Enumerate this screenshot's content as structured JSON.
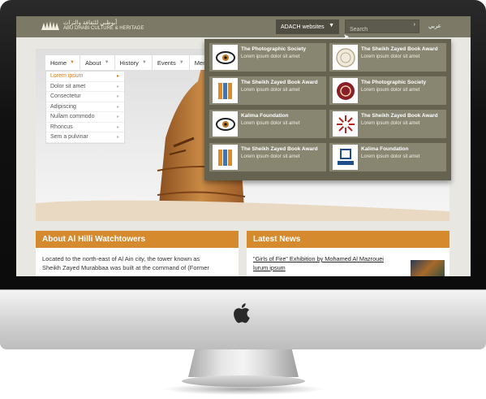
{
  "topbar": {
    "logo_ar": "أبوظبي للثقافة والتراث",
    "logo_en": "ABU DHABI CULTURE & HERITAGE",
    "adach_label": "ADACH websites",
    "search_placeholder": "Search",
    "search_go": "›",
    "lang": "عربي"
  },
  "nav": {
    "items": [
      "Home",
      "About",
      "History",
      "Events",
      "Menu I"
    ]
  },
  "submenu": {
    "items": [
      "Lorem ipsum",
      "Dolor sit amet",
      "Consectetur",
      "Adipiscing",
      "Nullam commodo",
      "Rhoncus",
      "Sem a pulvinar"
    ]
  },
  "dropdown": {
    "tiles": [
      {
        "title": "The Photographic Society",
        "desc": "Lorem ipsum dolor sit amet",
        "icon": "eye-icon"
      },
      {
        "title": "The Sheikh Zayed Book Award",
        "desc": "Lorem ipsum dolor sit amet",
        "icon": "seal-icon"
      },
      {
        "title": "The Sheikh Zayed Book Award",
        "desc": "Lorem ipsum dolor sit amet",
        "icon": "book-award-icon"
      },
      {
        "title": "The Photographic Society",
        "desc": "Lorem ipsum dolor sit amet",
        "icon": "red-seal-icon"
      },
      {
        "title": "Kalima Foundation",
        "desc": "Lorem ipsum dolor sit amet",
        "icon": "eye-icon"
      },
      {
        "title": "The Sheikh Zayed Book Award",
        "desc": "Lorem ipsum dolor sit amet",
        "icon": "sunburst-icon"
      },
      {
        "title": "The Sheikh Zayed Book Award",
        "desc": "Lorem ipsum dolor sit amet",
        "icon": "book-award-icon"
      },
      {
        "title": "Kalima Foundation",
        "desc": "Lorem ipsum dolor sit amet",
        "icon": "kalima-icon"
      }
    ]
  },
  "about": {
    "title": "About Al Hilli Watchtowers",
    "line1": "Located to the north-east of Al Ain city, the tower known as",
    "line2": "Sheikh Zayed Murabbaa was built at the command of (Former"
  },
  "news": {
    "title": "Latest News",
    "link1": "\"Girls of Fire\" Exhibition by Mohamed Al Mazrouei",
    "link2": "lurum ipsum"
  },
  "colors": {
    "accent": "#d68a2e",
    "topbar": "#7c7a66",
    "dropdown": "#65634f"
  }
}
